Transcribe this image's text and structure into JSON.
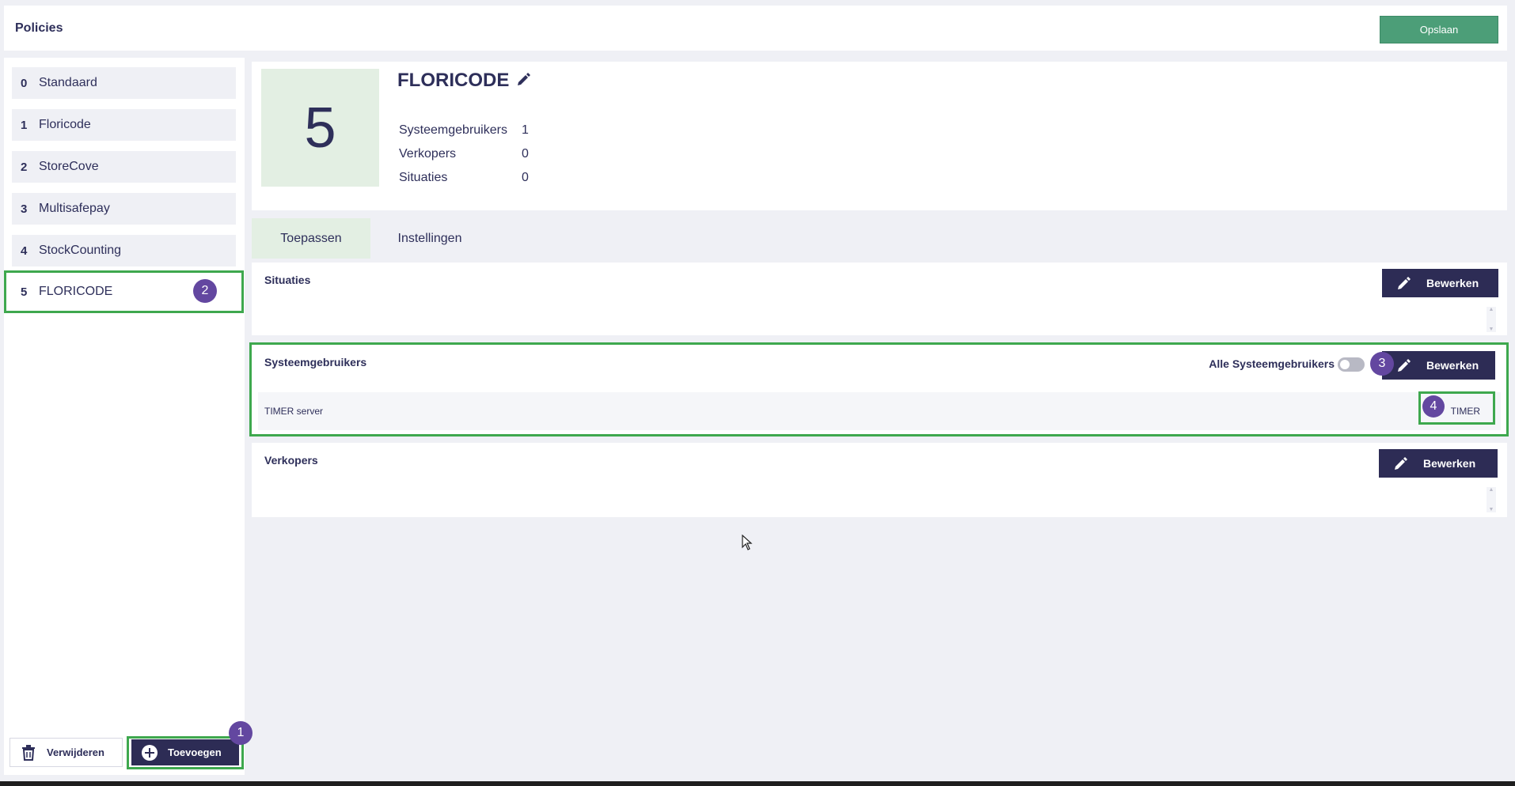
{
  "header": {
    "title": "Policies",
    "save_label": "Opslaan"
  },
  "sidebar": {
    "items": [
      {
        "num": "0",
        "label": "Standaard"
      },
      {
        "num": "1",
        "label": "Floricode"
      },
      {
        "num": "2",
        "label": "StoreCove"
      },
      {
        "num": "3",
        "label": "Multisafepay"
      },
      {
        "num": "4",
        "label": "StockCounting"
      },
      {
        "num": "5",
        "label": "FLORICODE"
      }
    ],
    "selected_index": 5,
    "delete_label": "Verwijderen",
    "add_label": "Toevoegen"
  },
  "policy": {
    "number": "5",
    "name": "FLORICODE",
    "stats": [
      {
        "label": "Systeemgebruikers",
        "value": "1"
      },
      {
        "label": "Verkopers",
        "value": "0"
      },
      {
        "label": "Situaties",
        "value": "0"
      }
    ]
  },
  "tabs": [
    {
      "label": "Toepassen",
      "active": true
    },
    {
      "label": "Instellingen",
      "active": false
    }
  ],
  "sections": {
    "situaties": {
      "title": "Situaties",
      "edit_label": "Bewerken"
    },
    "systeemgebruikers": {
      "title": "Systeemgebruikers",
      "edit_label": "Bewerken",
      "toggle_label": "Alle Systeemgebruikers",
      "toggle_on": false,
      "rows": [
        {
          "name": "TIMER server",
          "tag": "TIMER"
        }
      ]
    },
    "verkopers": {
      "title": "Verkopers",
      "edit_label": "Bewerken"
    }
  },
  "annotations": {
    "b1": "1",
    "b2": "2",
    "b3": "3",
    "b4": "4"
  },
  "colors": {
    "primary": "#2d2c55",
    "save": "#4c9e78",
    "highlight": "#3ea84e",
    "badge": "#6347a0",
    "active_tab": "#e3efe3"
  },
  "icons": {
    "edit": "pencil-icon",
    "delete": "trash-icon",
    "add": "plus-circle-icon"
  }
}
